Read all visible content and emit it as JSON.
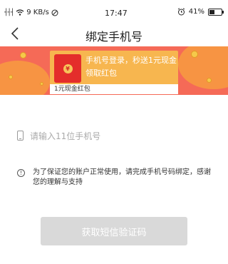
{
  "status_bar": {
    "signal": "┤┤┤",
    "network_speed": "9 KB/s",
    "time": "17:47",
    "battery": "41%",
    "battery_level": 0.41
  },
  "nav": {
    "title": "绑定手机号"
  },
  "banner": {
    "headline": "手机号登录，秒送1元现金",
    "subline": "领取红包",
    "caption": "1元现金红包",
    "redpacket_symbol": "¥",
    "colors": {
      "background": "#f56a57",
      "card": "#f7b64f",
      "redpacket": "#e42d2b"
    }
  },
  "phone_input": {
    "placeholder": "请输入11位手机号",
    "value": ""
  },
  "notice": {
    "icon_symbol": "!",
    "text": "为了保证您的账户正常使用，请完成手机号码绑定，感谢您的理解与支持"
  },
  "actions": {
    "get_code_label": "获取短信验证码",
    "button_color": "#d9d9d9"
  }
}
